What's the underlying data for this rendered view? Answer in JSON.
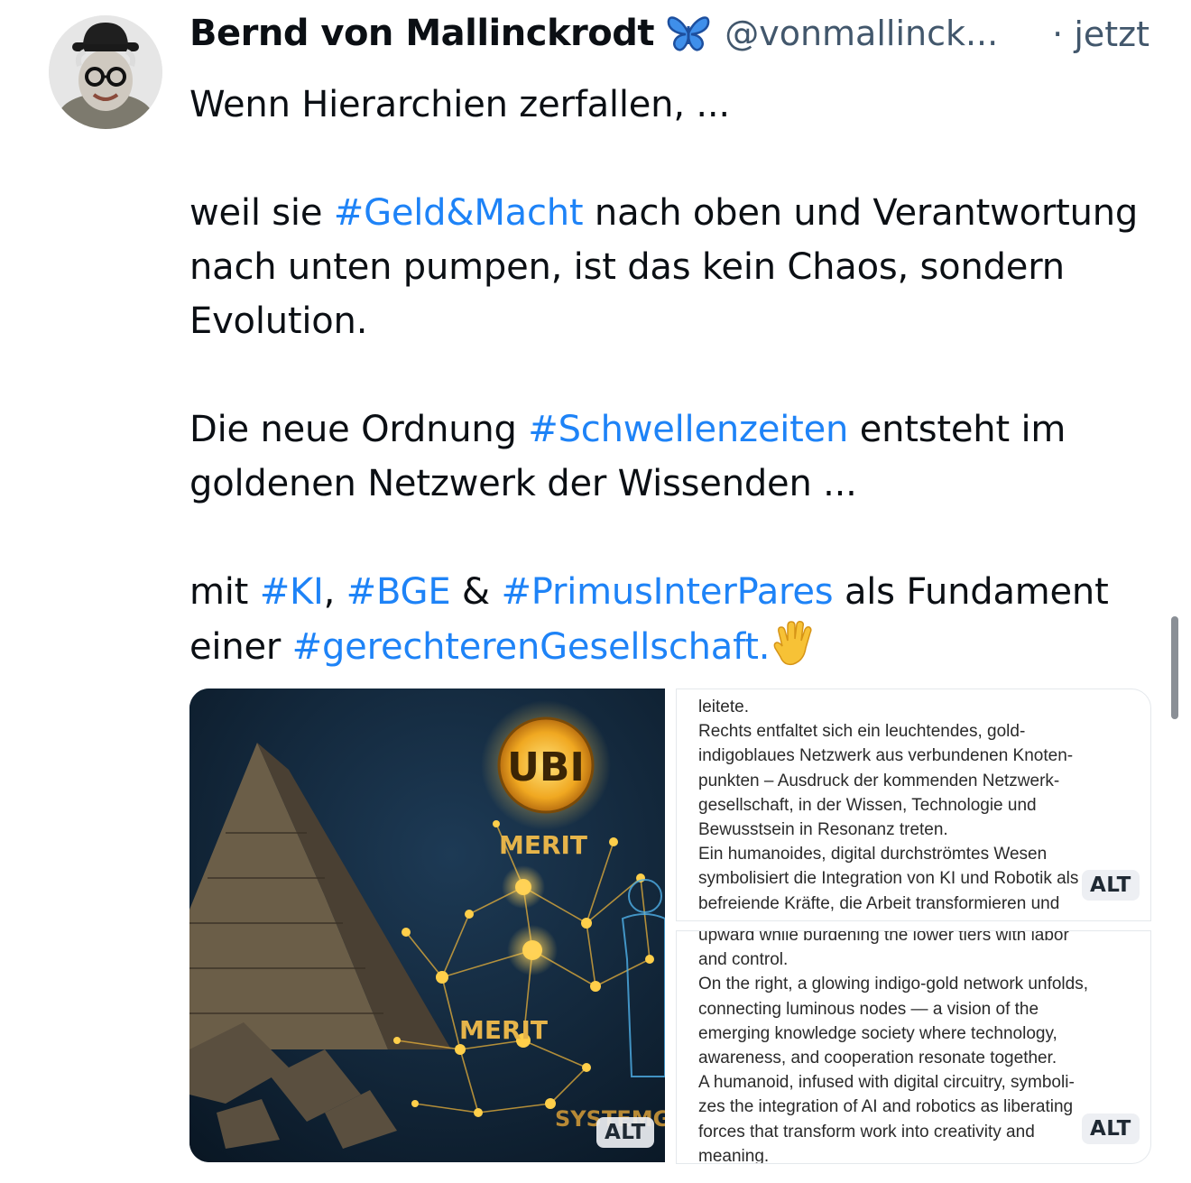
{
  "post": {
    "author": "Bernd von Mallinckrodt",
    "handle": "@vonmallinck...",
    "time": "· jetzt",
    "line1": "Wenn Hierarchien zerfallen, ...",
    "p2_a": "weil sie ",
    "p2_tag": "#Geld&Macht",
    "p2_b": " nach oben und Verantwortung nach unten pumpen, ist das kein Chaos, sondern Evolution.",
    "p3_a": "Die neue Ordnung ",
    "p3_tag": "#Schwellenzeiten",
    "p3_b": " entsteht im goldenen Netzwerk der Wissenden ...",
    "p4_a": "mit ",
    "p4_tag1": "#KI",
    "p4_sep1": ", ",
    "p4_tag2": "#BGE",
    "p4_sep2": " & ",
    "p4_tag3": "#PrimusInterPares",
    "p4_b": " als Fundament einer ",
    "p4_tag4": "#gerechterenGesellschaft.",
    "emoji": "raised-hand-emoji"
  },
  "media": {
    "image_labels": {
      "ubi": "UBI",
      "merit1": "MERIT",
      "merit2": "MERIT",
      "system": "SYSTEMGR"
    },
    "alt_label": "ALT",
    "alt_de": "leitete.\nRechts entfaltet sich ein leuchtendes, gold-\nindigoblaues Netzwerk aus verbundenen Knoten-\npunkten – Ausdruck der kommenden Netzwerk-\ngesellschaft, in der Wissen, Technologie und\nBewusstsein in Resonanz treten.\nEin humanoides, digital durchströmtes Wesen\nsymbolisiert die Integration von KI und Robotik als\nbefreiende Kräfte, die Arbeit transformieren und",
    "alt_en": "upward while burdening the lower tiers with labor\nand control.\nOn the right, a glowing indigo-gold network unfolds,\nconnecting luminous nodes — a vision of the\nemerging knowledge society where technology,\nawareness, and cooperation resonate together.\nA humanoid, infused with digital circuitry, symboli-\nzes the integration of AI and robotics as liberating\nforces that transform work into creativity and\nmeaning."
  },
  "colors": {
    "hashtag": "#1e83f7",
    "muted": "#42576c",
    "text": "#0b0f14"
  }
}
